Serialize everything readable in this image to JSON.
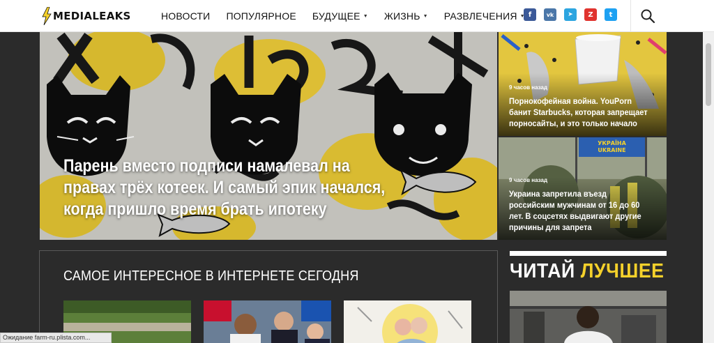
{
  "header": {
    "logo_text": "MEDIALEAKS",
    "nav": [
      {
        "label": "НОВОСТИ"
      },
      {
        "label": "ПОПУЛЯРНОЕ"
      },
      {
        "label": "БУДУЩЕЕ"
      },
      {
        "label": "ЖИЗНЬ"
      },
      {
        "label": "РАЗВЛЕЧЕНИЯ"
      }
    ],
    "socials": [
      {
        "icon": "facebook-icon",
        "glyph": "f",
        "color": "#3b5998"
      },
      {
        "icon": "vk-icon",
        "glyph": "vk",
        "color": "#4a76a8"
      },
      {
        "icon": "telegram-icon",
        "glyph": "➤",
        "color": "#2ca5e0"
      },
      {
        "icon": "zen-icon",
        "glyph": "Z",
        "color": "#e0332e"
      },
      {
        "icon": "twitter-icon",
        "glyph": "t",
        "color": "#1da1f2"
      }
    ],
    "search_icon": "search-icon"
  },
  "hero": {
    "title_lines": [
      "Парень вместо подписи намалевал на",
      "правах трёх котеек. И самый эпик начался,",
      "когда пришло время брать ипотеку"
    ]
  },
  "side_news": [
    {
      "time": "9 часов назад",
      "title_lines": [
        "Порнокофейная война. YouPorn",
        "банит Starbucks, которая запрещает",
        "порносайты, и это только начало"
      ]
    },
    {
      "time": "9 часов назад",
      "title_lines": [
        "Украина запретила въезд",
        "российским мужчинам от 16 до 60",
        "лет. В соцсетях выдвигают другие",
        "причины для запрета"
      ],
      "sign_text_top": "УКРАЇНА",
      "sign_text_bottom": "UKRAINE"
    }
  ],
  "section": {
    "title": "САМОЕ ИНТЕРЕСНОЕ В ИНТЕРНЕТЕ СЕГОДНЯ"
  },
  "read_best": {
    "word1": "ЧИТАЙ",
    "word2": "ЛУЧШЕЕ"
  },
  "statusbar": {
    "text": "Ожидание farm-ru.plista.com..."
  },
  "colors": {
    "accent_yellow": "#f5d12b",
    "page_bg": "#2b2b2b"
  }
}
